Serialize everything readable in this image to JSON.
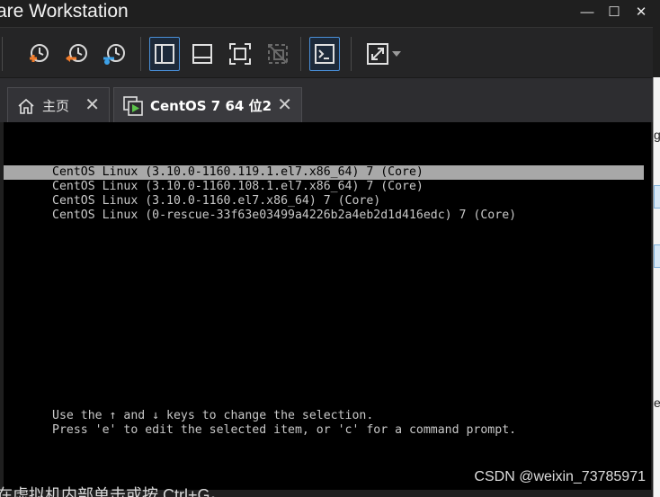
{
  "window": {
    "title": "are Workstation",
    "controls": {
      "minimize": "—",
      "maximize": "☐",
      "close": "✕"
    }
  },
  "toolbar": {
    "items": [
      {
        "name": "snapshot-take-icon"
      },
      {
        "name": "snapshot-revert-icon"
      },
      {
        "name": "snapshot-manager-icon"
      },
      {
        "name": "show-library-icon",
        "active": true
      },
      {
        "name": "thumbnail-bar-icon"
      },
      {
        "name": "full-screen-icon"
      },
      {
        "name": "unity-icon",
        "disabled": true
      },
      {
        "name": "console-view-icon",
        "active": true
      },
      {
        "name": "stretch-guest-icon"
      }
    ],
    "colors": {
      "accent_orange": "#f07b2a",
      "accent_blue": "#3da1e8",
      "active_border": "#4a90d9"
    }
  },
  "tabs": [
    {
      "label": "主页",
      "icon": "home-icon"
    },
    {
      "label": "CentOS 7 64 位2",
      "icon": "vm-icon",
      "active": true
    }
  ],
  "console": {
    "entries": [
      "CentOS Linux (3.10.0-1160.119.1.el7.x86_64) 7 (Core)",
      "CentOS Linux (3.10.0-1160.108.1.el7.x86_64) 7 (Core)",
      "CentOS Linux (3.10.0-1160.el7.x86_64) 7 (Core)",
      "CentOS Linux (0-rescue-33f63e03499a4226b2a4eb2d1d416edc) 7 (Core)"
    ],
    "selected_index": 0,
    "help_line1": "Use the ↑ and ↓ keys to change the selection.",
    "help_line2": "Press 'e' to edit the selected item, or 'c' for a command prompt."
  },
  "statusbar": {
    "text": "在虚拟机内部单击或按 Ctrl+G。"
  },
  "watermark": "CSDN @weixin_73785971",
  "background_window": {
    "fragments": [
      "g",
      "e"
    ]
  }
}
